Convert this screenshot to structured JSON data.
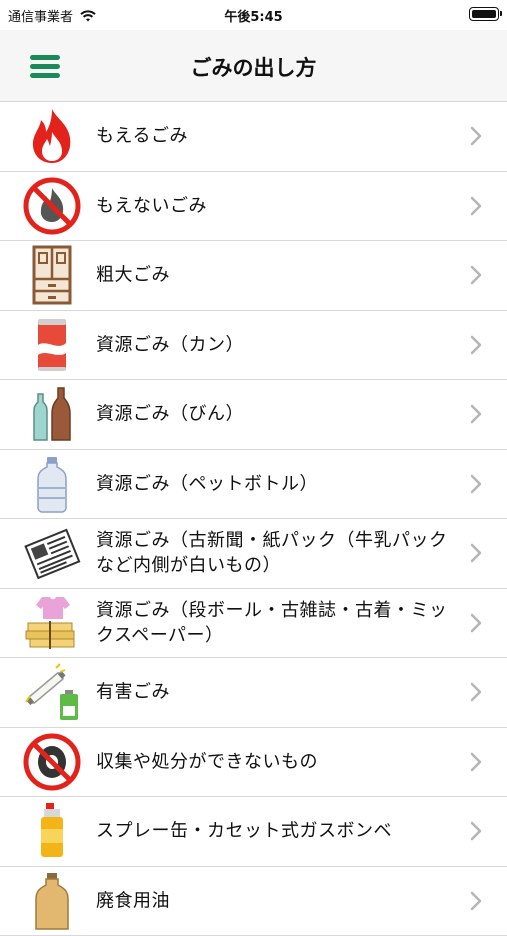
{
  "status_bar": {
    "carrier": "通信事業者",
    "time": "午後5:45"
  },
  "header": {
    "title": "ごみの出し方",
    "menu_icon": "hamburger-menu-icon",
    "accent_color": "#1a8a5a"
  },
  "items": [
    {
      "label": "もえるごみ",
      "icon": "flame-icon"
    },
    {
      "label": "もえないごみ",
      "icon": "no-burn-icon"
    },
    {
      "label": "粗大ごみ",
      "icon": "cabinet-icon"
    },
    {
      "label": "資源ごみ（カン）",
      "icon": "can-icon"
    },
    {
      "label": "資源ごみ（びん）",
      "icon": "bottles-icon"
    },
    {
      "label": "資源ごみ（ペットボトル）",
      "icon": "pet-bottle-icon"
    },
    {
      "label": "資源ごみ（古新聞・紙パック（牛乳パックなど内側が白いもの）",
      "icon": "newspaper-icon"
    },
    {
      "label": "資源ごみ（段ボール・古雑誌・古着・ミックスペーパー）",
      "icon": "cardboard-clothes-icon"
    },
    {
      "label": "有害ごみ",
      "icon": "fluorescent-battery-icon"
    },
    {
      "label": "収集や処分ができないもの",
      "icon": "no-tire-icon"
    },
    {
      "label": "スプレー缶・カセット式ガスボンベ",
      "icon": "spray-can-icon"
    },
    {
      "label": "廃食用油",
      "icon": "oil-bottle-icon"
    }
  ]
}
